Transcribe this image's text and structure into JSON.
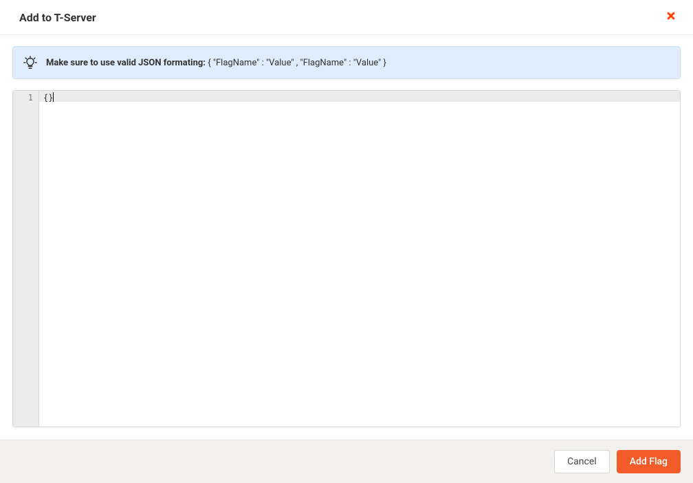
{
  "header": {
    "title": "Add to T-Server"
  },
  "banner": {
    "bold_text": "Make sure to use valid JSON formating: ",
    "example_text": "{ \"FlagName\" : \"Value\" , \"FlagName\" : \"Value\" }"
  },
  "editor": {
    "line_number": "1",
    "content": "{}"
  },
  "footer": {
    "cancel_label": "Cancel",
    "submit_label": "Add Flag"
  }
}
